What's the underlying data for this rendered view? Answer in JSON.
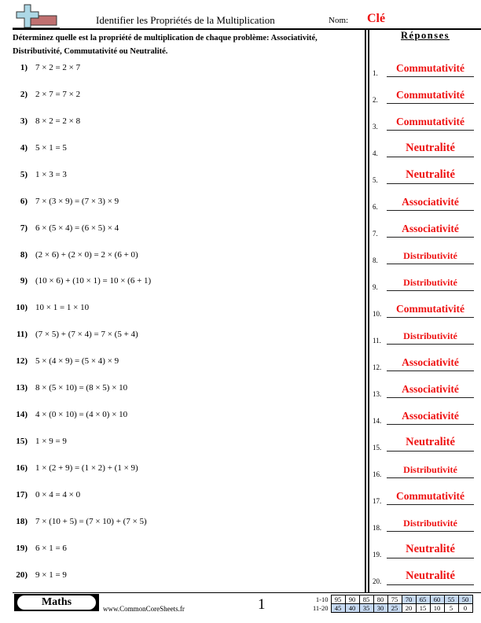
{
  "header": {
    "title": "Identifier les Propriétés de la Multiplication",
    "name_label": "Nom:",
    "name_value": "Clé",
    "logo_icon": "plus-and-minus-icon"
  },
  "instructions": "Déterminez quelle est la propriété de multiplication de chaque problème: Associativité, Distributivité, Commutativité ou Neutralité.",
  "answers_heading": "Réponses",
  "problems": [
    {
      "num": "1)",
      "expr": "7 × 2 = 2 × 7"
    },
    {
      "num": "2)",
      "expr": "2 × 7 = 7 × 2"
    },
    {
      "num": "3)",
      "expr": "8 × 2 = 2 × 8"
    },
    {
      "num": "4)",
      "expr": "5 × 1 = 5"
    },
    {
      "num": "5)",
      "expr": "1 × 3 = 3"
    },
    {
      "num": "6)",
      "expr": "7 × (3 × 9) = (7 × 3) × 9"
    },
    {
      "num": "7)",
      "expr": "6 × (5 × 4) = (6 × 5) × 4"
    },
    {
      "num": "8)",
      "expr": "(2 × 6) + (2 × 0) = 2 × (6 + 0)"
    },
    {
      "num": "9)",
      "expr": "(10 × 6) + (10 × 1) = 10 × (6 + 1)"
    },
    {
      "num": "10)",
      "expr": "10 × 1 = 1 × 10"
    },
    {
      "num": "11)",
      "expr": "(7 × 5) + (7 × 4) = 7 × (5 + 4)"
    },
    {
      "num": "12)",
      "expr": "5 × (4 × 9) = (5 × 4) × 9"
    },
    {
      "num": "13)",
      "expr": "8 × (5 × 10) = (8 × 5) × 10"
    },
    {
      "num": "14)",
      "expr": "4 × (0 × 10) = (4 × 0) × 10"
    },
    {
      "num": "15)",
      "expr": "1 × 9 = 9"
    },
    {
      "num": "16)",
      "expr": "1 × (2 + 9) = (1 × 2) + (1 × 9)"
    },
    {
      "num": "17)",
      "expr": "0 × 4 = 4 × 0"
    },
    {
      "num": "18)",
      "expr": "7 × (10 + 5) = (7 × 10) + (7 × 5)"
    },
    {
      "num": "19)",
      "expr": "6 × 1 = 6"
    },
    {
      "num": "20)",
      "expr": "9 × 1 = 9"
    }
  ],
  "answers": [
    {
      "num": "1.",
      "text": "Commutativité"
    },
    {
      "num": "2.",
      "text": "Commutativité"
    },
    {
      "num": "3.",
      "text": "Commutativité"
    },
    {
      "num": "4.",
      "text": "Neutralité"
    },
    {
      "num": "5.",
      "text": "Neutralité"
    },
    {
      "num": "6.",
      "text": "Associativité"
    },
    {
      "num": "7.",
      "text": "Associativité"
    },
    {
      "num": "8.",
      "text": "Distributivité"
    },
    {
      "num": "9.",
      "text": "Distributivité"
    },
    {
      "num": "10.",
      "text": "Commutativité"
    },
    {
      "num": "11.",
      "text": "Distributivité"
    },
    {
      "num": "12.",
      "text": "Associativité"
    },
    {
      "num": "13.",
      "text": "Associativité"
    },
    {
      "num": "14.",
      "text": "Associativité"
    },
    {
      "num": "15.",
      "text": "Neutralité"
    },
    {
      "num": "16.",
      "text": "Distributivité"
    },
    {
      "num": "17.",
      "text": "Commutativité"
    },
    {
      "num": "18.",
      "text": "Distributivité"
    },
    {
      "num": "19.",
      "text": "Neutralité"
    },
    {
      "num": "20.",
      "text": "Neutralité"
    }
  ],
  "footer": {
    "subject": "Maths",
    "website": "www.CommonCoreSheets.fr",
    "page_number": "1",
    "score_table": [
      {
        "label": "1-10",
        "values": [
          "95",
          "90",
          "85",
          "80",
          "75",
          "70",
          "65",
          "60",
          "55",
          "50"
        ],
        "shaded": [
          false,
          false,
          false,
          false,
          false,
          true,
          true,
          true,
          true,
          true
        ]
      },
      {
        "label": "11-20",
        "values": [
          "45",
          "40",
          "35",
          "30",
          "25",
          "20",
          "15",
          "10",
          "5",
          "0"
        ],
        "shaded": [
          true,
          true,
          true,
          true,
          true,
          false,
          false,
          false,
          false,
          false
        ]
      }
    ]
  },
  "colors": {
    "answer_red": "#ee1111",
    "score_shade": "#c6d9f1",
    "logo_plus": "#add8e6",
    "logo_minus": "#c07070"
  }
}
